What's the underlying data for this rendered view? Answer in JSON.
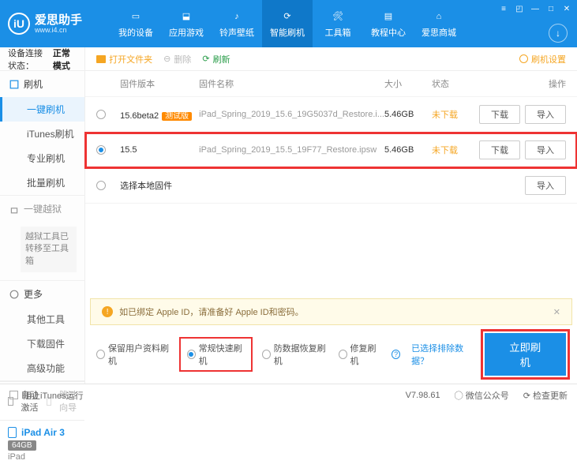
{
  "app": {
    "name": "爱思助手",
    "site": "www.i4.cn",
    "logo_letter": "iU"
  },
  "nav": {
    "items": [
      {
        "label": "我的设备",
        "icon": "phone"
      },
      {
        "label": "应用游戏",
        "icon": "apps"
      },
      {
        "label": "铃声壁纸",
        "icon": "music"
      },
      {
        "label": "智能刷机",
        "icon": "refresh"
      },
      {
        "label": "工具箱",
        "icon": "toolbox"
      },
      {
        "label": "教程中心",
        "icon": "book"
      },
      {
        "label": "爱思商城",
        "icon": "cart"
      }
    ],
    "active_index": 3
  },
  "sidebar": {
    "conn_label": "设备连接状态：",
    "conn_status": "正常模式",
    "groups": {
      "flash": {
        "title": "刷机",
        "items": [
          "一键刷机",
          "iTunes刷机",
          "专业刷机",
          "批量刷机"
        ],
        "active_index": 0
      },
      "jailbreak": {
        "title": "一键越狱",
        "note": "越狱工具已转移至工具箱"
      },
      "more": {
        "title": "更多",
        "items": [
          "其他工具",
          "下载固件",
          "高级功能"
        ]
      }
    },
    "auto_activate": "自动激活",
    "skip_guide": "跳过向导",
    "device": {
      "name": "iPad Air 3",
      "capacity": "64GB",
      "type": "iPad"
    }
  },
  "toolbar": {
    "open_folder": "打开文件夹",
    "delete": "删除",
    "refresh": "刷新",
    "settings": "刷机设置"
  },
  "table": {
    "headers": {
      "version": "固件版本",
      "name": "固件名称",
      "size": "大小",
      "status": "状态",
      "ops": "操作"
    },
    "download_btn": "下载",
    "import_btn": "导入",
    "rows": [
      {
        "version": "15.6beta2",
        "beta": "测试版",
        "name": "iPad_Spring_2019_15.6_19G5037d_Restore.i...",
        "size": "5.46GB",
        "status": "未下载",
        "selected": false
      },
      {
        "version": "15.5",
        "beta": "",
        "name": "iPad_Spring_2019_15.5_19F77_Restore.ipsw",
        "size": "5.46GB",
        "status": "未下载",
        "selected": true
      }
    ],
    "local_firmware": "选择本地固件"
  },
  "warning": "如已绑定 Apple ID，请准备好 Apple ID和密码。",
  "modes": {
    "keep_data": "保留用户资料刷机",
    "normal": "常规快速刷机",
    "recovery": "防数据恢复刷机",
    "repair": "修复刷机",
    "exclude_link": "已选择排除数据？",
    "flash_btn": "立即刷机"
  },
  "statusbar": {
    "block_itunes": "阻止iTunes运行",
    "version": "V7.98.61",
    "wechat": "微信公众号",
    "check_update": "检查更新"
  }
}
